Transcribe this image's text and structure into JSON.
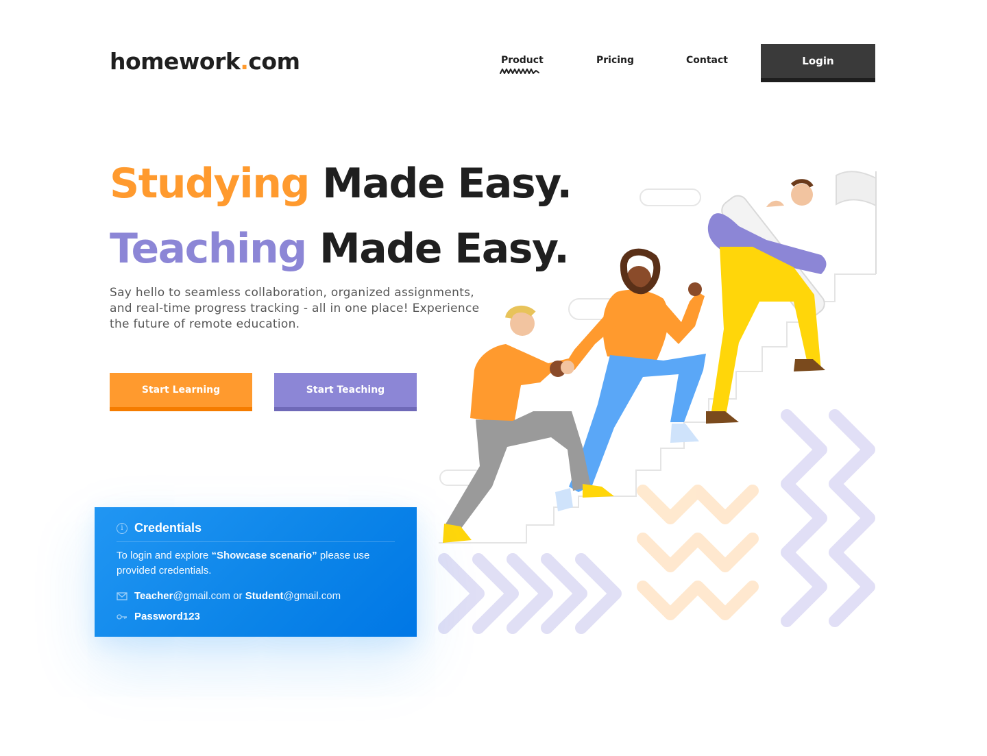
{
  "header": {
    "logo_name": "homework",
    "logo_dot": ".",
    "logo_tld": "com",
    "nav": {
      "product": "Product",
      "pricing": "Pricing",
      "contact": "Contact"
    },
    "login_label": "Login"
  },
  "hero": {
    "line1_accent": "Studying",
    "line1_rest": " Made Easy.",
    "line2_accent": "Teaching",
    "line2_rest": " Made Easy.",
    "subtext": "Say hello to seamless collaboration, organized assignments, and real-time progress tracking - all in one place! Experience the future of remote education.",
    "cta_learn": "Start Learning",
    "cta_teach": "Start Teaching"
  },
  "credentials": {
    "title": "Credentials",
    "desc_before": "To login and explore ",
    "desc_highlight": "“Showcase scenario”",
    "desc_after": " please use provided credentials.",
    "teacher_user": "Teacher",
    "email_domain_1": "@gmail.com",
    "or_text": " or ",
    "student_user": "Student",
    "email_domain_2": "@gmail.com",
    "password": "Password123"
  },
  "colors": {
    "orange": "#ff9a2e",
    "purple": "#8c86d6",
    "dark": "#1f1f1f",
    "login_bg": "#3a3a3a",
    "card_blue": "#0b84e8"
  },
  "icons": {
    "nav_underline": "squiggle-underline-icon",
    "info": "info-icon",
    "mail": "mail-icon",
    "key": "key-icon"
  }
}
